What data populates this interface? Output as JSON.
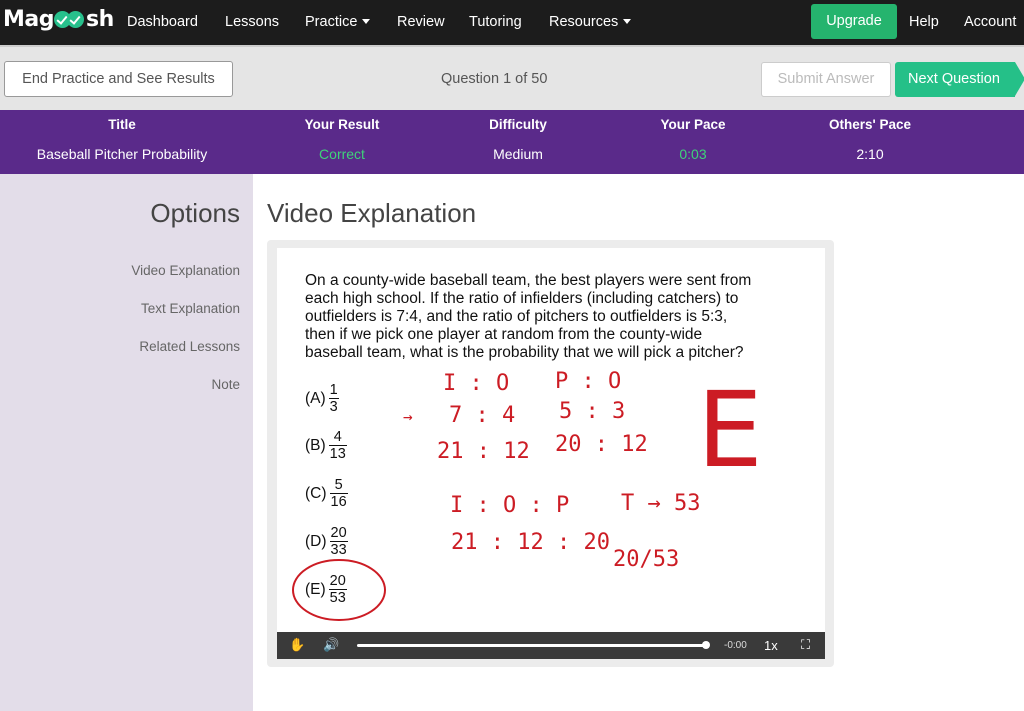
{
  "nav": {
    "logo_text_left": "Mag",
    "logo_text_right": "sh",
    "links": [
      "Dashboard",
      "Lessons",
      "Practice",
      "Review",
      "Tutoring",
      "Resources"
    ],
    "upgrade": "Upgrade",
    "help": "Help",
    "account": "Account"
  },
  "toolbar": {
    "end_practice": "End Practice and See Results",
    "question_count": "Question 1 of 50",
    "submit": "Submit Answer",
    "next": "Next Question"
  },
  "stats": {
    "headers": [
      "Title",
      "Your Result",
      "Difficulty",
      "Your Pace",
      "Others' Pace"
    ],
    "values": [
      "Baseball Pitcher Probability",
      "Correct",
      "Medium",
      "0:03",
      "2:10"
    ]
  },
  "sidebar": {
    "title": "Options",
    "items": [
      "Video Explanation",
      "Text Explanation",
      "Related Lessons",
      "Note"
    ]
  },
  "main": {
    "title": "Video Explanation"
  },
  "video": {
    "question_lines": [
      "On a county-wide baseball team, the best players were sent from",
      "each high school.  If the ratio of infielders (including catchers) to",
      "outfielders is 7:4, and the ratio of pitchers to outfielders is 5:3,",
      "then if we pick one player at random from the county-wide",
      "baseball team, what is the probability that we will pick a pitcher?"
    ],
    "choices": [
      {
        "label": "(A)",
        "num": "1",
        "den": "3"
      },
      {
        "label": "(B)",
        "num": "4",
        "den": "13"
      },
      {
        "label": "(C)",
        "num": "5",
        "den": "16"
      },
      {
        "label": "(D)",
        "num": "20",
        "den": "33"
      },
      {
        "label": "(E)",
        "num": "20",
        "den": "53"
      }
    ],
    "handwriting": {
      "line1_left": "I : O",
      "line1_right": "P : O",
      "line2_left": "7 : 4",
      "line2_right": "5 : 3",
      "line3_left": "21 : 12",
      "line3_right": "20 : 12",
      "line4_left": "I : O : P",
      "line4_right": "T → 53",
      "line5_left": "21 : 12 : 20",
      "line5_right": "20/53",
      "answer_letter": "E",
      "arrow": "→"
    },
    "time": "-0:00",
    "speed": "1x",
    "ink_color": "#cc1c24"
  },
  "colors": {
    "nav_bg": "#1c1c1c",
    "stats_bg": "#5a2a8a",
    "accent_green": "#25c088",
    "sidebar_bg": "#e3dde9"
  }
}
